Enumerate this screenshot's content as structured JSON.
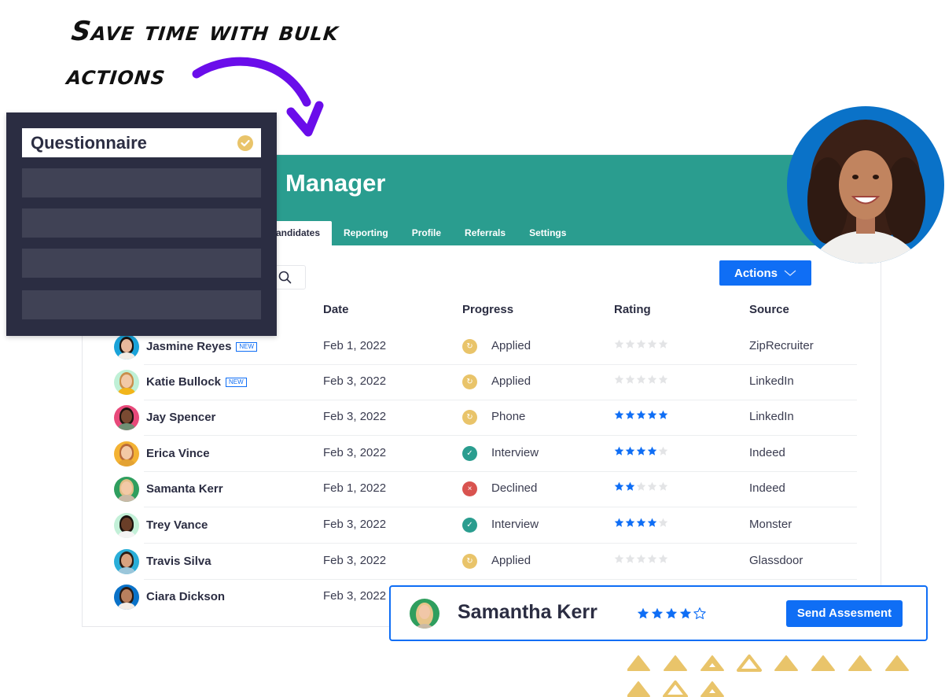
{
  "headline": {
    "line1": "Save time with bulk",
    "line2": "actions"
  },
  "colors": {
    "header_teal": "#2a9d8f",
    "accent_blue": "#0f6ef5",
    "overlay_dark": "#2b2d42",
    "arrow_purple": "#6a0dea",
    "status_applied": "#e9c46a",
    "status_interview": "#2a9d8f",
    "status_declined": "#d9534f",
    "star_filled": "#0f6ef5",
    "star_empty": "#e3e4e6",
    "triangle_gold": "#e9c46a"
  },
  "overlay": {
    "selected_label": "Questionnaire",
    "selected_icon": "check-circle-icon",
    "placeholder_items": 4
  },
  "app": {
    "title": "Manager",
    "tabs": [
      {
        "label": "Candidates",
        "visible_label": "andidates",
        "active": true
      },
      {
        "label": "Reporting",
        "active": false
      },
      {
        "label": "Profile",
        "active": false
      },
      {
        "label": "Referrals",
        "active": false
      },
      {
        "label": "Settings",
        "active": false
      }
    ],
    "search_icon": "search-icon",
    "actions_label": "Actions",
    "actions_icon": "chevron-down-icon"
  },
  "table": {
    "columns": [
      "Date",
      "Progress",
      "Rating",
      "Source"
    ],
    "rows": [
      {
        "name": "Jasmine Reyes",
        "badge": "NEW",
        "date": "Feb 1, 2022",
        "status": "Applied",
        "status_type": "applied",
        "rating": 0,
        "source": "ZipRecruiter"
      },
      {
        "name": "Katie Bullock",
        "badge": "NEW",
        "date": "Feb 3, 2022",
        "status": "Applied",
        "status_type": "applied",
        "rating": 0,
        "source": "LinkedIn"
      },
      {
        "name": "Jay Spencer",
        "badge": "",
        "date": "Feb 3, 2022",
        "status": "Phone",
        "status_type": "applied",
        "rating": 5,
        "source": "LinkedIn"
      },
      {
        "name": "Erica Vince",
        "badge": "",
        "date": "Feb 3, 2022",
        "status": "Interview",
        "status_type": "interview",
        "rating": 4,
        "source": "Indeed"
      },
      {
        "name": "Samanta Kerr",
        "badge": "",
        "date": "Feb 1, 2022",
        "status": "Declined",
        "status_type": "declined",
        "rating": 2,
        "source": "Indeed"
      },
      {
        "name": "Trey Vance",
        "badge": "",
        "date": "Feb 3, 2022",
        "status": "Interview",
        "status_type": "interview",
        "rating": 4,
        "source": "Monster"
      },
      {
        "name": "Travis Silva",
        "badge": "",
        "date": "Feb 3, 2022",
        "status": "Applied",
        "status_type": "applied",
        "rating": 0,
        "source": "Glassdoor"
      },
      {
        "name": "Ciara Dickson",
        "badge": "",
        "date": "Feb 3, 2022",
        "status": "",
        "status_type": "",
        "rating": null,
        "source": ""
      }
    ]
  },
  "candidate_bar": {
    "name": "Samantha Kerr",
    "rating": 4,
    "max_rating": 5,
    "button_label": "Send Assesment"
  }
}
